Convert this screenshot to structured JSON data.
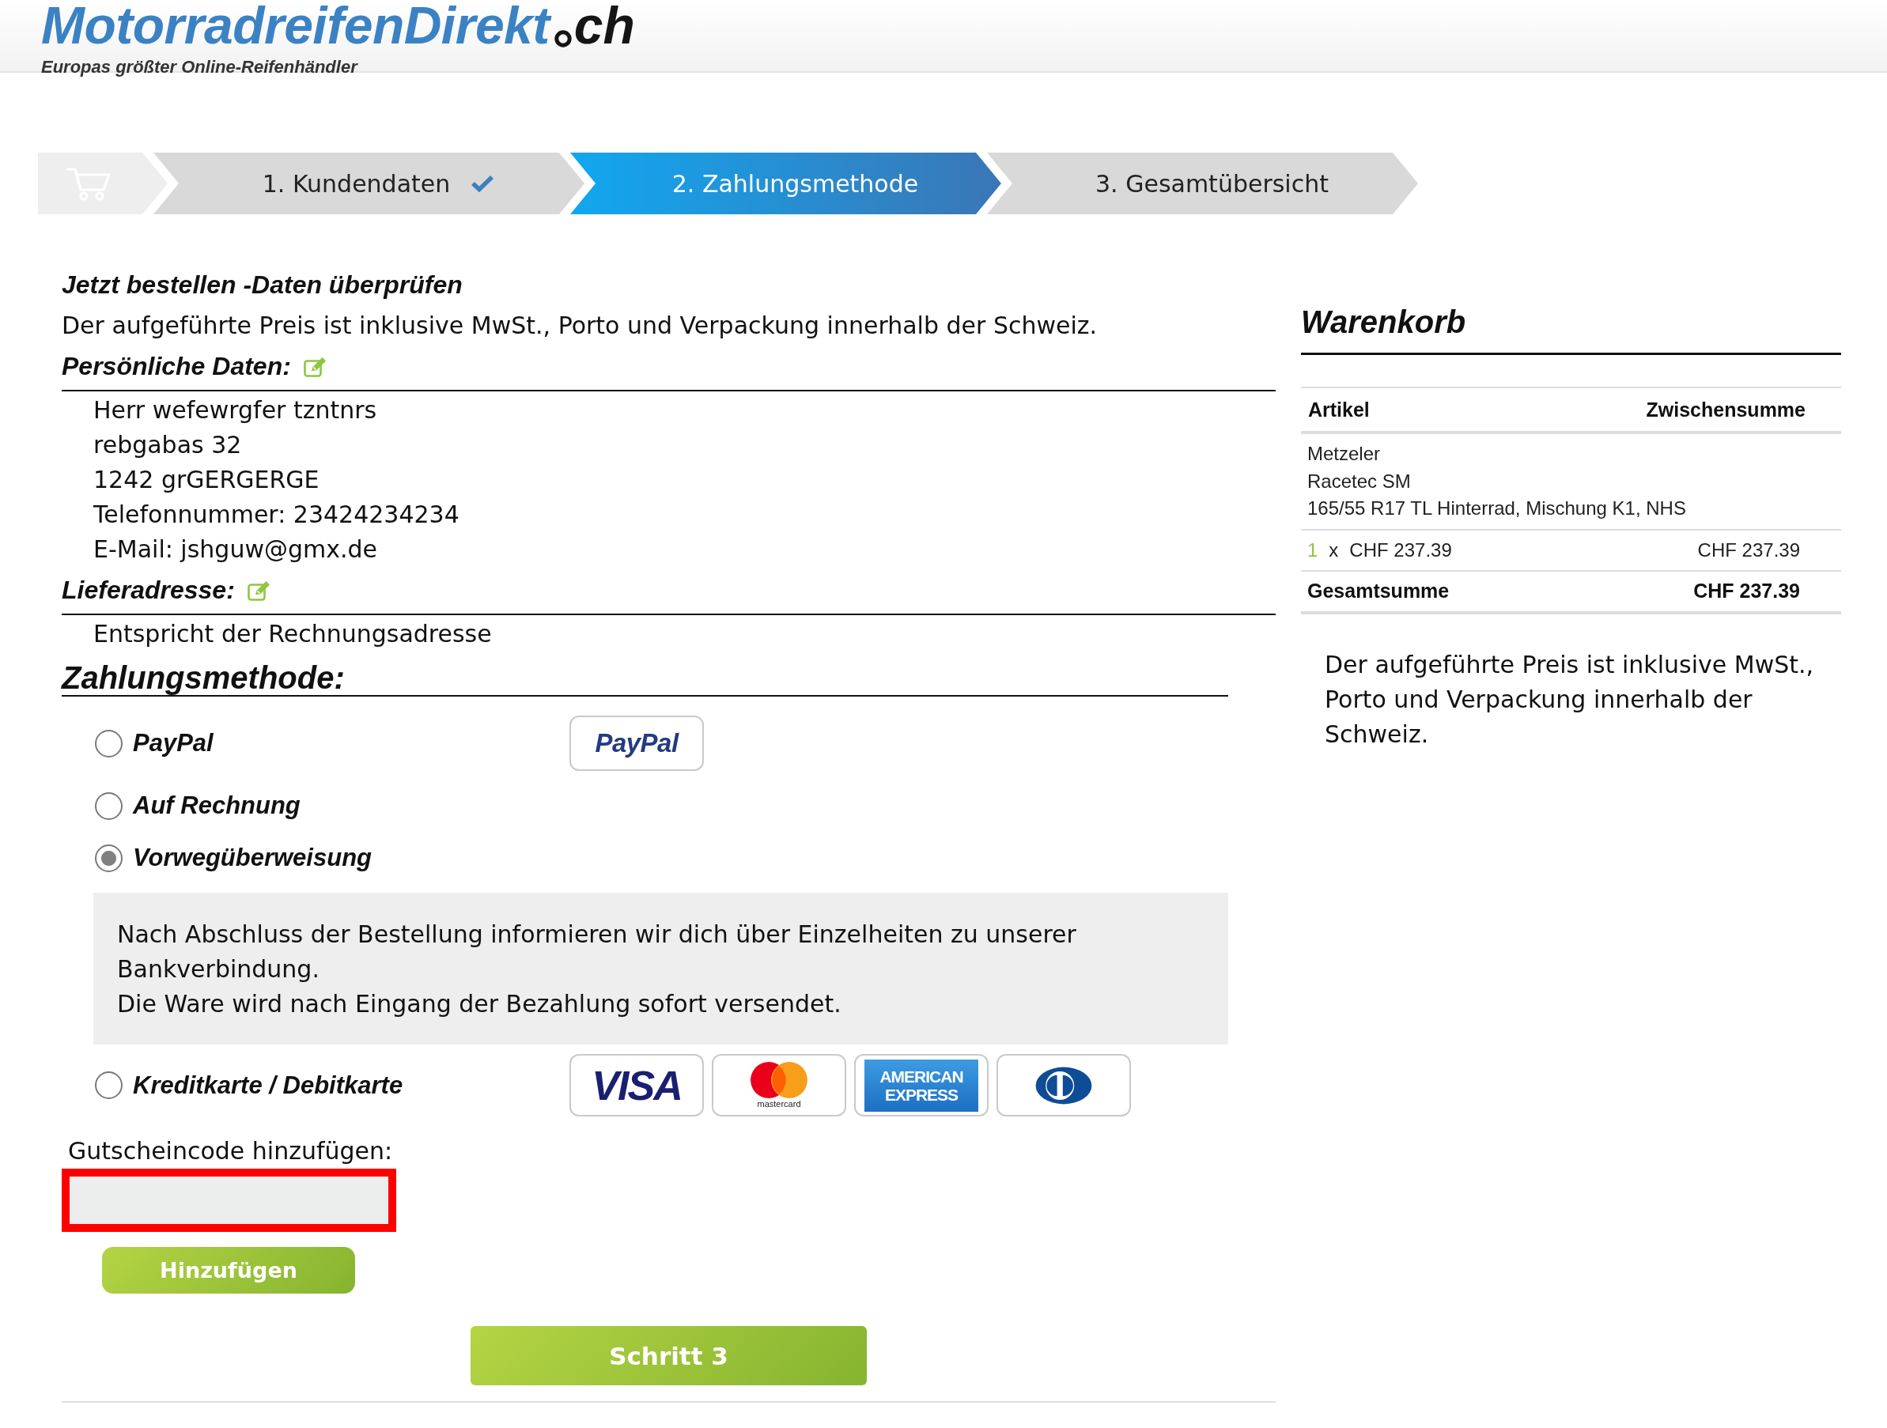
{
  "header": {
    "logo": {
      "name": "MotorradreifenDirekt",
      "tld": "ch"
    },
    "tagline": "Europas größter Online-Reifenhändler"
  },
  "steps": [
    {
      "kind": "cart",
      "selected": false
    },
    {
      "kind": "step",
      "label": "1. Kundendaten",
      "selected": false,
      "done": true
    },
    {
      "kind": "step",
      "label": "2. Zahlungsmethode",
      "selected": true,
      "done": false
    },
    {
      "kind": "step",
      "label": "3. Gesamtübersicht",
      "selected": false,
      "done": false
    }
  ],
  "review": {
    "title": "Jetzt bestellen -Daten überprüfen",
    "note": "Der aufgeführte Preis ist inklusive MwSt., Porto und Verpackung innerhalb der Schweiz.",
    "sections": [
      {
        "title": "Persönliche Daten:",
        "editable": true,
        "lines": [
          "Herr wefewrgfer tzntnrs",
          "rebgabas 32",
          "1242 grGERGERGE",
          "Telefonnummer: 23424234234",
          "E-Mail: jshguw@gmx.de"
        ]
      },
      {
        "title": "Lieferadresse:",
        "editable": true,
        "lines": [
          "Entspricht der Rechnungsadresse"
        ]
      }
    ]
  },
  "payment": {
    "title": "Zahlungsmethode:",
    "methods": [
      {
        "label": "PayPal",
        "selected": false,
        "logos": [
          {
            "kind": "paypal",
            "text": "PayPal"
          }
        ]
      },
      {
        "label": "Auf Rechnung",
        "selected": false
      },
      {
        "label": "Vorwegüberweisung",
        "selected": true,
        "details": [
          "Nach Abschluss der Bestellung informieren wir dich über Einzelheiten zu unserer Bankverbindung.",
          "Die Ware wird nach Eingang der Bezahlung sofort versendet."
        ]
      },
      {
        "label": "Kreditkarte / Debitkarte",
        "selected": false,
        "logos": [
          {
            "kind": "visa",
            "text": "VISA"
          },
          {
            "kind": "mastercard",
            "text": "mastercard"
          },
          {
            "kind": "amex",
            "text": "AMERICAN EXPRESS"
          },
          {
            "kind": "diners"
          }
        ]
      }
    ]
  },
  "coupon": {
    "label": "Gutscheincode hinzufügen:",
    "invalid": true,
    "button": "Hinzufügen"
  },
  "submit": {
    "label": "Schritt 3"
  },
  "cart": {
    "title": "Warenkorb",
    "columns": [
      "Artikel",
      "Zwischensumme"
    ],
    "items": [
      {
        "lines": [
          "Metzeler",
          "Racetec SM",
          "165/55 R17 TL Hinterrad, Mischung K1, NHS"
        ],
        "quantity": "1",
        "times": "x",
        "unit_price": "CHF 237.39",
        "subtotal": "CHF 237.39"
      }
    ],
    "total": {
      "label": "Gesamtsumme",
      "value": "CHF 237.39"
    },
    "note": "Der aufgeführte Preis ist inklusive MwSt., Porto und Verpackung innerhalb der Schweiz."
  }
}
